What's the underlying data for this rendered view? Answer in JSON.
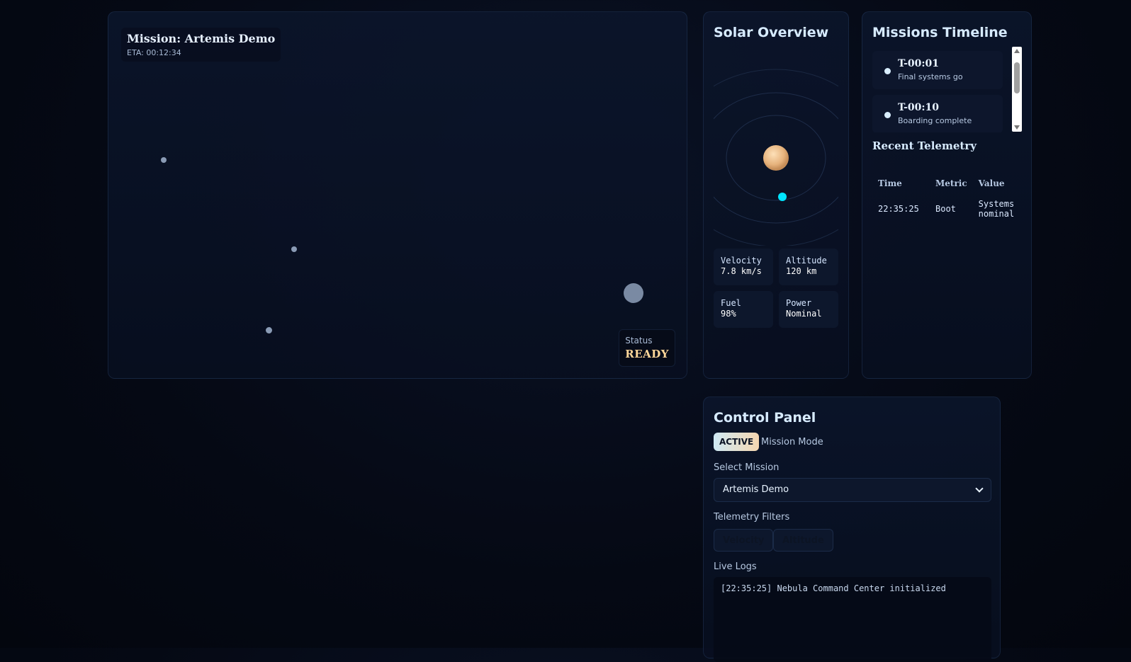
{
  "map": {
    "title": "Mission: Artemis Demo",
    "eta": "ETA: 00:12:34",
    "status_label": "Status",
    "status_value": "READY"
  },
  "solar": {
    "title": "Solar Overview",
    "stats": [
      {
        "label": "Velocity",
        "value": "7.8 km/s"
      },
      {
        "label": "Altitude",
        "value": "120 km"
      },
      {
        "label": "Fuel",
        "value": "98%"
      },
      {
        "label": "Power",
        "value": "Nominal"
      }
    ]
  },
  "missions": {
    "title": "Missions Timeline",
    "timeline": [
      {
        "time": "T-00:01",
        "desc": "Final systems go"
      },
      {
        "time": "T-00:10",
        "desc": "Boarding complete"
      }
    ],
    "telemetry_title": "Recent Telemetry",
    "telemetry_headers": [
      "Time",
      "Metric",
      "Value"
    ],
    "telemetry_rows": [
      {
        "time": "22:35:25",
        "metric": "Boot",
        "value": "Systems nominal"
      }
    ]
  },
  "control": {
    "title": "Control Panel",
    "badge": "ACTIVE",
    "badge_label": "Mission Mode",
    "select_label": "Select Mission",
    "select_value": "Artemis Demo",
    "filters_label": "Telemetry Filters",
    "filters": [
      "Velocity",
      "Altitude"
    ],
    "logs_label": "Live Logs",
    "logs": [
      "[22:35:25] Nebula Command Center initialized"
    ]
  },
  "colors": {
    "accent_cyan": "#00e5ff",
    "status_gold": "#ffd79a",
    "sun": "#e9b883"
  }
}
